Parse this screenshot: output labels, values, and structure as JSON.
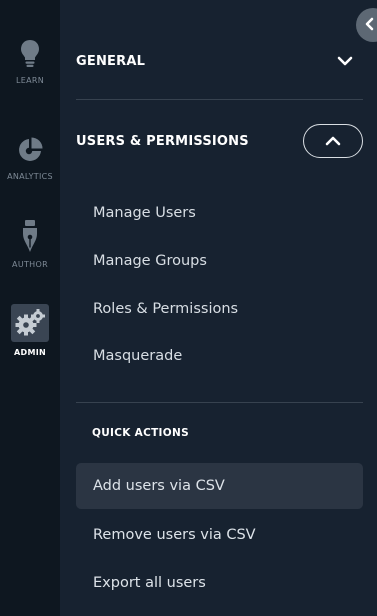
{
  "rail": {
    "items": [
      {
        "label": "LEARN",
        "icon": "lightbulb-icon",
        "active": false
      },
      {
        "label": "ANALYTICS",
        "icon": "pie-chart-icon",
        "active": false
      },
      {
        "label": "AUTHOR",
        "icon": "pen-nib-icon",
        "active": false
      },
      {
        "label": "ADMIN",
        "icon": "gears-icon",
        "active": true
      }
    ]
  },
  "collapse_button": {
    "icon": "chevron-left-icon"
  },
  "sections": {
    "general": {
      "title": "GENERAL",
      "icon": "chevron-down-icon",
      "expanded": false
    },
    "users": {
      "title": "USERS & PERMISSIONS",
      "icon": "chevron-up-icon",
      "expanded": true,
      "items": [
        "Manage Users",
        "Manage Groups",
        "Roles & Permissions",
        "Masquerade"
      ]
    }
  },
  "quick_actions": {
    "title": "QUICK ACTIONS",
    "items": [
      {
        "label": "Add users via CSV",
        "selected": true
      },
      {
        "label": "Remove users via CSV",
        "selected": false
      },
      {
        "label": "Export all users",
        "selected": false
      }
    ]
  },
  "colors": {
    "rail_bg": "#0e1720",
    "panel_bg": "#172230",
    "selected_bg": "#2b3543",
    "text": "#d8dee4",
    "muted": "#7e8a96"
  }
}
